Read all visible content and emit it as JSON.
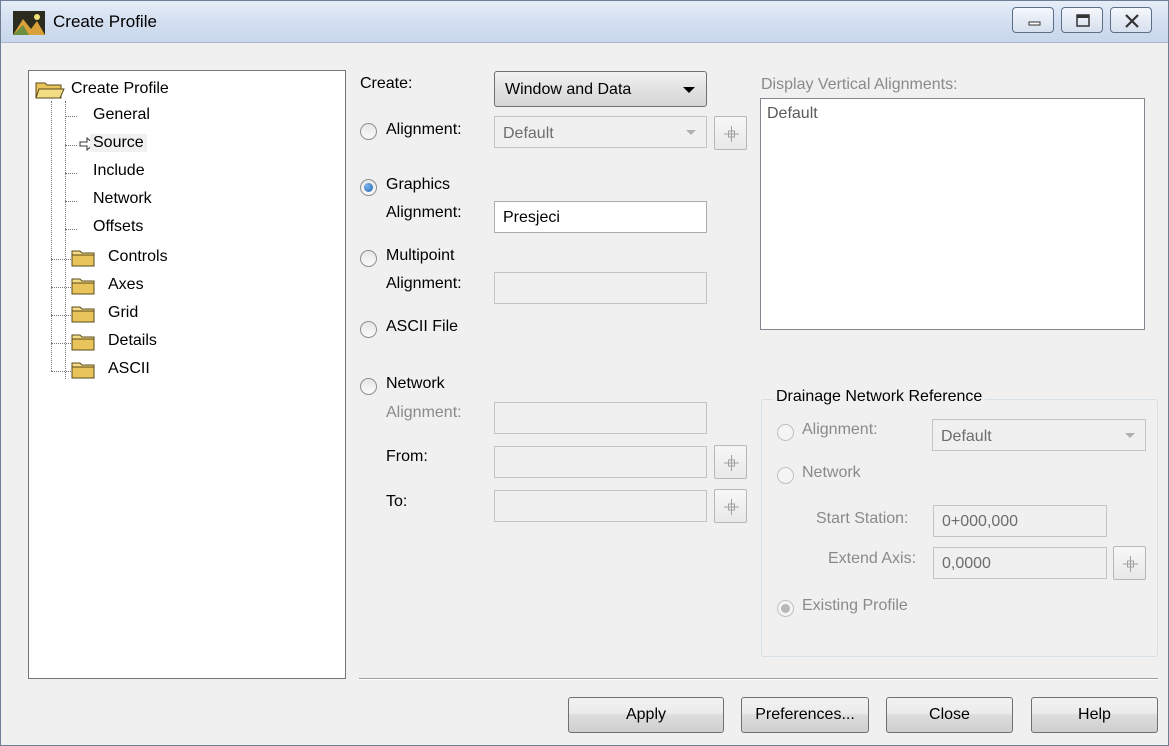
{
  "window": {
    "title": "Create Profile"
  },
  "tree": {
    "root": "Create Profile",
    "items": [
      "General",
      "Source",
      "Include",
      "Network",
      "Offsets"
    ],
    "folders": [
      "Controls",
      "Axes",
      "Grid",
      "Details",
      "ASCII"
    ]
  },
  "create": {
    "label": "Create:",
    "value": "Window and Data"
  },
  "source": {
    "alignment_label": "Alignment:",
    "alignment_value": "Default",
    "graphics_label": "Graphics",
    "graphics_sub_label": "Alignment:",
    "graphics_value": "Presjeci",
    "multipoint_label": "Multipoint",
    "multipoint_sub_label": "Alignment:",
    "multipoint_value": "",
    "ascii_label": "ASCII File",
    "network_label": "Network",
    "network_alignment_label": "Alignment:",
    "network_alignment_value": "",
    "from_label": "From:",
    "from_value": "",
    "to_label": "To:",
    "to_value": "",
    "selected": "Graphics"
  },
  "display_vertical": {
    "label": "Display Vertical Alignments:",
    "items": [
      "Default"
    ]
  },
  "drainage": {
    "title": "Drainage Network Reference",
    "alignment_label": "Alignment:",
    "alignment_value": "Default",
    "network_label": "Network",
    "start_station_label": "Start Station:",
    "start_station_value": "0+000,000",
    "extend_axis_label": "Extend Axis:",
    "extend_axis_value": "0,0000",
    "existing_profile_label": "Existing Profile"
  },
  "buttons": {
    "apply": "Apply",
    "preferences": "Preferences...",
    "close": "Close",
    "help": "Help"
  },
  "colors": {
    "titlebar": "#d3dff0",
    "selected_radio": "#1e5fa8",
    "folder": "#e8c45a"
  }
}
